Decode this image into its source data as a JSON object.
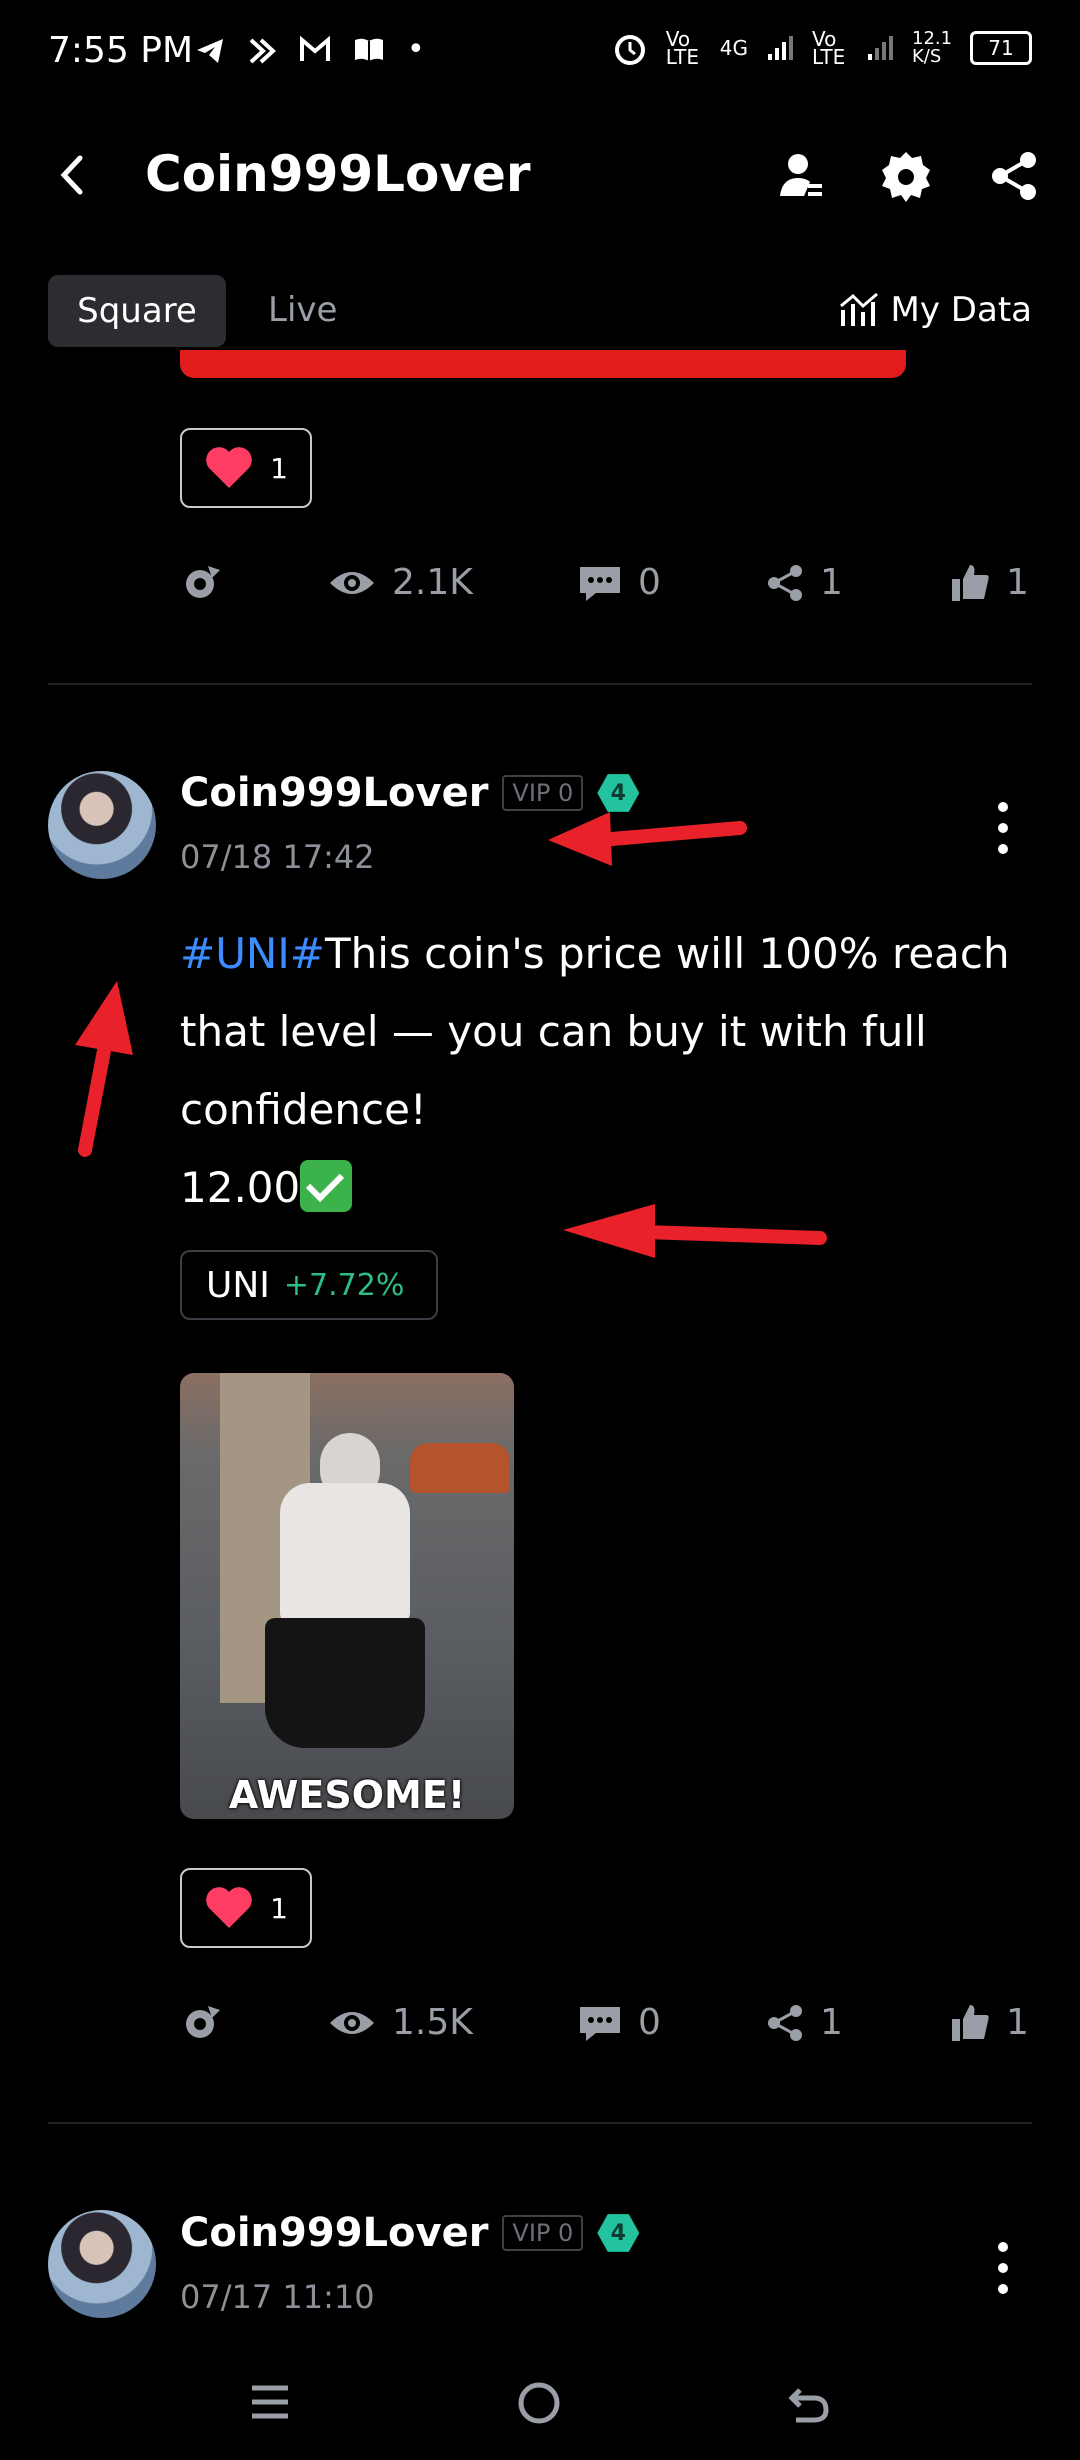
{
  "status_bar": {
    "time": "7:55 PM",
    "left_icons": [
      "telegram-icon",
      "kotak-icon",
      "gmail-icon",
      "book-icon",
      "dot-icon"
    ],
    "network_1": "Vo LTE",
    "network_4g": "4G",
    "network_2": "Vo LTE",
    "speed": "12.1 K/S",
    "battery": "71"
  },
  "header": {
    "title": "Coin999Lover",
    "icons": [
      "back-icon",
      "profile-icon",
      "settings-icon",
      "share-icon"
    ]
  },
  "tabs": {
    "square": "Square",
    "live": "Live",
    "my_data": "My Data"
  },
  "post_prev": {
    "reaction_count": "1",
    "views": "2.1K",
    "comments": "0",
    "shares": "1",
    "likes": "1"
  },
  "post_main": {
    "username": "Coin999Lover",
    "vip": "VIP 0",
    "level": "4",
    "date": "07/18 17:42",
    "hashtag": "#UNI#",
    "text": "This coin's price will 100% reach that level — you can buy it with full confidence!",
    "price_line": "12.00",
    "coin_tag": {
      "name": "UNI",
      "change": "+7.72%"
    },
    "media_caption": "AWESOME!",
    "reaction_count": "1",
    "views": "1.5K",
    "comments": "0",
    "shares": "1",
    "likes": "1"
  },
  "post_next": {
    "username": "Coin999Lover",
    "vip": "VIP 0",
    "level": "4",
    "date": "07/17 11:10"
  },
  "colors": {
    "background": "#000000",
    "accent_link": "#3b8cff",
    "positive": "#2ebd85",
    "annotation_arrow": "#e8212b"
  },
  "bottom_nav": [
    "menu-icon",
    "home-icon",
    "back-nav-icon"
  ]
}
